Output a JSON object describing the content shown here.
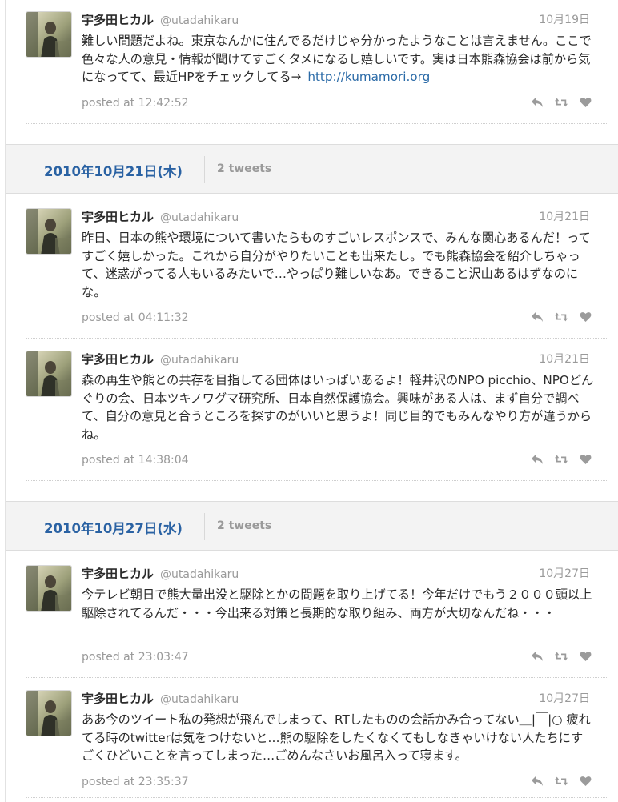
{
  "colors": {
    "accent": "#2a62a3",
    "link": "#2a6aa7",
    "muted": "#9a9a9a",
    "dayheader_bg": "#f3f3f3"
  },
  "icons": [
    "reply-icon",
    "retweet-icon",
    "favorite-icon"
  ],
  "tweets": [
    {
      "name": "宇多田ヒカル",
      "handle": "@utadahikaru",
      "date": "10月19日",
      "text": "難しい問題だよね。東京なんかに住んでるだけじゃ分かったようなことは言えません。ここで色々な人の意見・情報が聞けてすごくタメになるし嬉しいです。実は日本熊森協会は前から気になってて、最近HPをチェックしてる→",
      "link": "http://kumamori.org",
      "posted": "posted at 12:42:52"
    },
    {
      "name": "宇多田ヒカル",
      "handle": "@utadahikaru",
      "date": "10月21日",
      "text": "昨日、日本の熊や環境について書いたらものすごいレスポンスで、みんな関心あるんだ！ってすごく嬉しかった。これから自分がやりたいことも出来たし。でも熊森協会を紹介しちゃって、迷惑がってる人もいるみたいで…やっぱり難しいなあ。できること沢山あるはずなのにな。",
      "posted": "posted at 04:11:32"
    },
    {
      "name": "宇多田ヒカル",
      "handle": "@utadahikaru",
      "date": "10月21日",
      "text": "森の再生や熊との共存を目指してる団体はいっぱいあるよ！軽井沢のNPO picchio、NPOどんぐりの会、日本ツキノワグマ研究所、日本自然保護協会。興味がある人は、まず自分で調べて、自分の意見と合うところを探すのがいいと思うよ！同じ目的でもみんなやり方が違うからね。",
      "posted": "posted at 14:38:04"
    },
    {
      "name": "宇多田ヒカル",
      "handle": "@utadahikaru",
      "date": "10月27日",
      "text": "今テレビ朝日で熊大量出没と駆除とかの問題を取り上げてる！今年だけでもう２０００頭以上駆除されてるんだ・・・今出来る対策と長期的な取り組み、両方が大切なんだね・・・",
      "posted": "posted at 23:03:47"
    },
    {
      "name": "宇多田ヒカル",
      "handle": "@utadahikaru",
      "date": "10月27日",
      "text": "ああ今のツイート私の発想が飛んでしまって、RTしたものの会話かみ合ってない＿|￣|○ 疲れてる時のtwitterは気をつけないと…熊の駆除をしたくなくてもしなきゃいけない人たちにすごくひどいことを言ってしまった…ごめんなさいお風呂入って寝ます。",
      "posted": "posted at 23:35:37"
    }
  ],
  "day_headers": [
    {
      "date": "2010年10月21日(木)",
      "count": "2 tweets"
    },
    {
      "date": "2010年10月27日(水)",
      "count": "2 tweets"
    }
  ]
}
